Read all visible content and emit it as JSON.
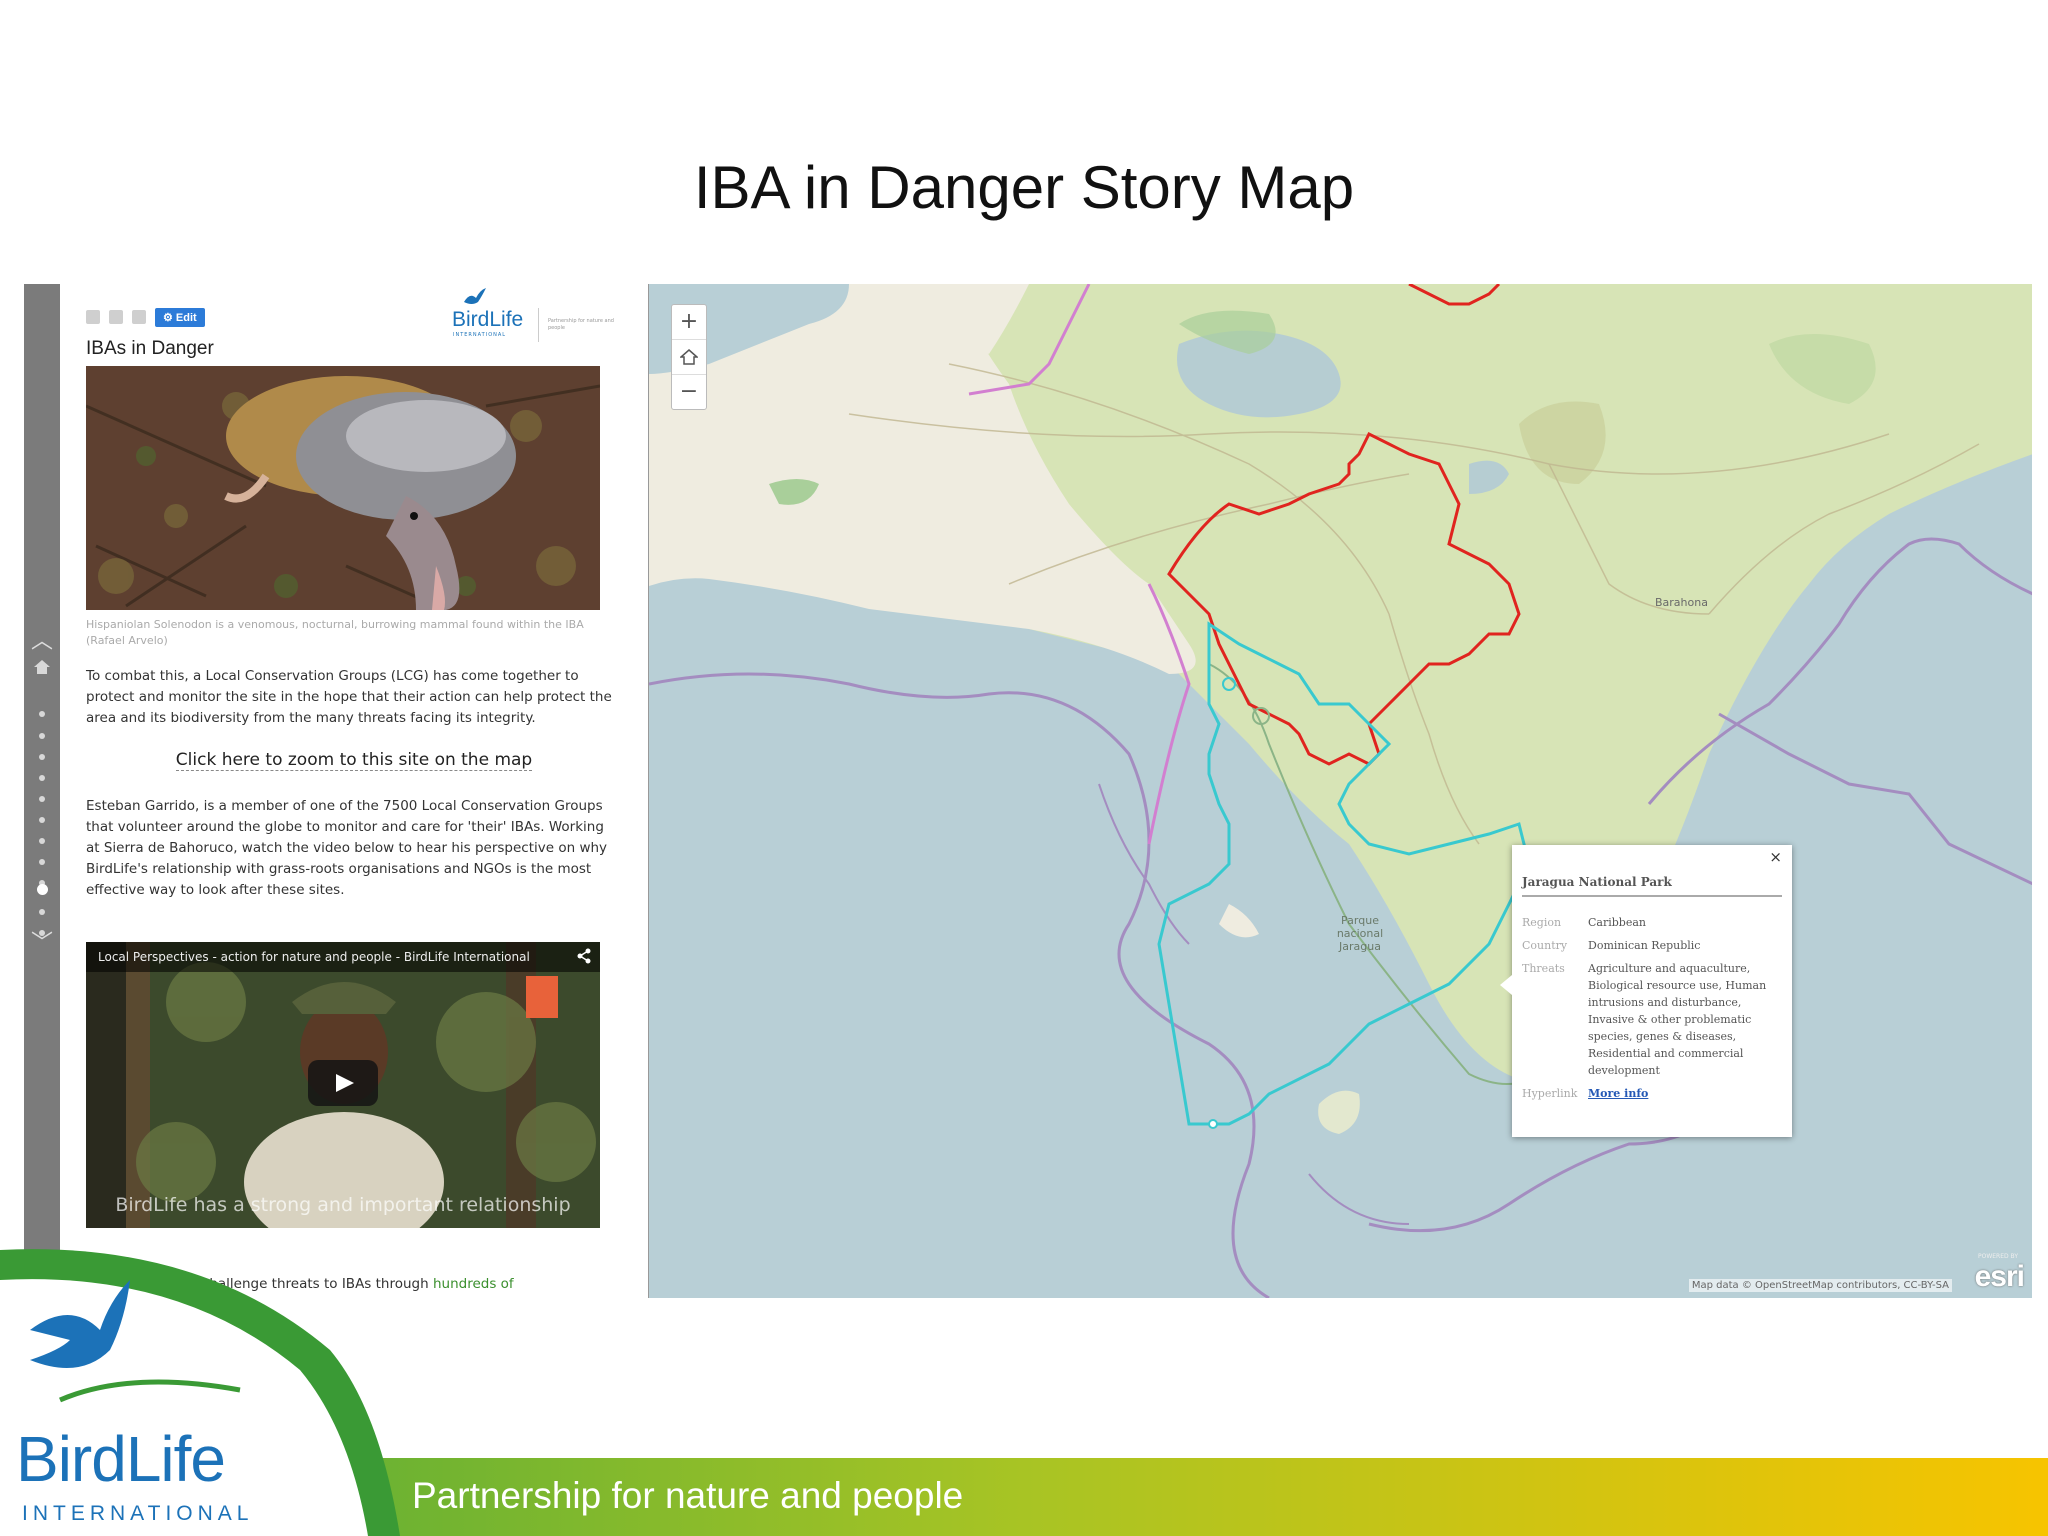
{
  "slide": {
    "title": "IBA in Danger Story Map"
  },
  "panel": {
    "edit_label": "Edit",
    "title": "IBAs in Danger",
    "logo_name": "BirdLife",
    "logo_sub": "INTERNATIONAL",
    "logo_tag": "Partnership for nature and people",
    "photo_caption": "Hispaniolan Solenodon is a venomous, nocturnal, burrowing mammal found within the IBA (Rafael Arvelo)",
    "paragraph_1": "To combat this, a Local Conservation Groups (LCG) has come together to protect and monitor the site in the hope that their action can help protect the area and its biodiversity from the many threats facing its integrity.",
    "zoom_link": "Click here to zoom to this site on the map",
    "paragraph_2": "Esteban Garrido, is a member of one of the 7500 Local Conservation Groups that volunteer around the globe to monitor and care for 'their' IBAs. Working at Sierra de Bahoruco, watch the video below to hear his perspective on why BirdLife's relationship with grass-roots organisations and NGOs is the most effective way to look after these sites.",
    "video_title": "Local Perspectives - action for nature and people - BirdLife International",
    "video_subtitle": "BirdLife has a strong and important relationship",
    "paragraph_3_start": "BirdLife Partners challenge threats to IBAs through ",
    "paragraph_3_link": "hundreds of"
  },
  "map": {
    "zoom_in": "+",
    "zoom_out": "−",
    "park_label": "Parque nacional Jaragua",
    "town_label": "Barahona",
    "popup": {
      "title": "Jaragua National Park",
      "rows": [
        {
          "key": "Region",
          "value": "Caribbean"
        },
        {
          "key": "Country",
          "value": "Dominican Republic"
        },
        {
          "key": "Threats",
          "value": "Agriculture and aquaculture, Biological resource use, Human intrusions and disturbance, Invasive & other problematic species, genes & diseases, Residential and commercial development"
        }
      ],
      "link_key": "Hyperlink",
      "link_label": "More info",
      "close": "×"
    },
    "attribution": "Map data © OpenStreetMap contributors, CC-BY-SA",
    "esri_powered": "POWERED BY",
    "esri": "esri"
  },
  "footer": {
    "logo_name": "BirdLife",
    "logo_sub": "INTERNATIONAL",
    "tagline": "Partnership for nature and people"
  },
  "colors": {
    "brand_blue": "#1c72b8",
    "brand_green": "#3a9a35",
    "footer_gradient_start": "#4aa83a",
    "footer_gradient_end": "#f7c400",
    "iba_boundary_red": "#e0241f",
    "marine_boundary_cyan": "#39c9cf",
    "eez_purple": "#a07ab8"
  }
}
